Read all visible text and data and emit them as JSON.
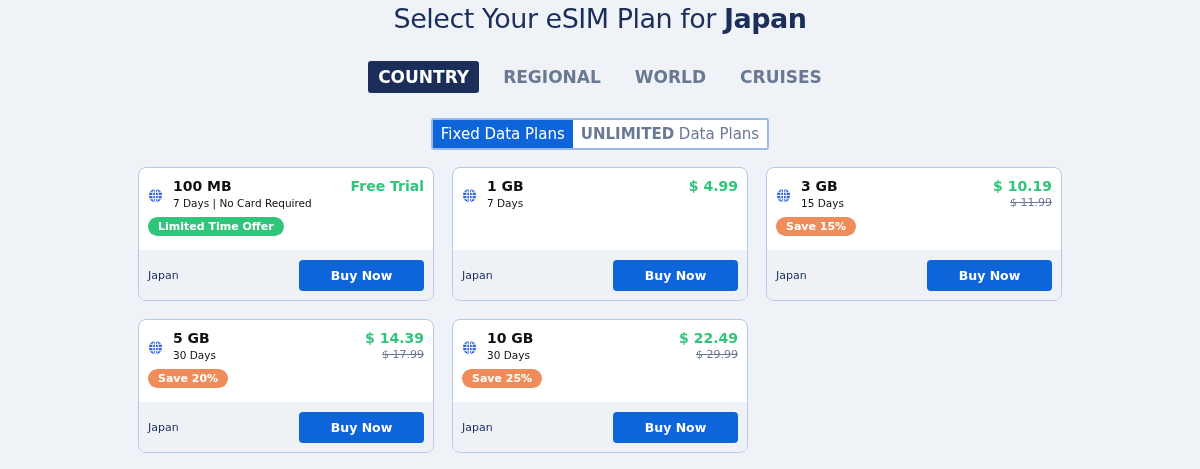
{
  "title": "Select Your eSIM Plan for **Japan**",
  "tabs": [
    {
      "label": "COUNTRY",
      "selected": true
    },
    {
      "label": "REGIONAL",
      "selected": false
    },
    {
      "label": "WORLD",
      "selected": false
    },
    {
      "label": "CRUISES",
      "selected": false
    }
  ],
  "plan_toggle": [
    {
      "label": "Fixed Data Plans",
      "selected": true
    },
    {
      "label": "**UNLIMITED** Data Plans",
      "selected": false
    }
  ],
  "plans": [
    {
      "data": "100 MB",
      "details": "7 Days | No Card Required",
      "price": "Free Trial",
      "badge": {
        "text": "Limited Time Offer",
        "color": "#2fc57a"
      },
      "country": "Japan",
      "button": "Buy Now"
    },
    {
      "data": "1 GB",
      "details": "7 Days",
      "price": "$ 4.99",
      "country": "Japan",
      "button": "Buy Now"
    },
    {
      "data": "3 GB",
      "details": "15 Days",
      "price": "$ 10.19",
      "original_price": "$ 11.99",
      "badge": {
        "text": "Save 15%",
        "color": "#ef8c5a"
      },
      "country": "Japan",
      "button": "Buy Now"
    },
    {
      "data": "5 GB",
      "details": "30 Days",
      "price": "$ 14.39",
      "original_price": "$ 17.99",
      "badge": {
        "text": "Save 20%",
        "color": "#ef8c5a"
      },
      "country": "Japan",
      "button": "Buy Now"
    },
    {
      "data": "10 GB",
      "details": "30 Days",
      "price": "$ 22.49",
      "original_price": "$ 29.99",
      "badge": {
        "text": "Save 25%",
        "color": "#ef8c5a"
      },
      "country": "Japan",
      "button": "Buy Now"
    }
  ]
}
